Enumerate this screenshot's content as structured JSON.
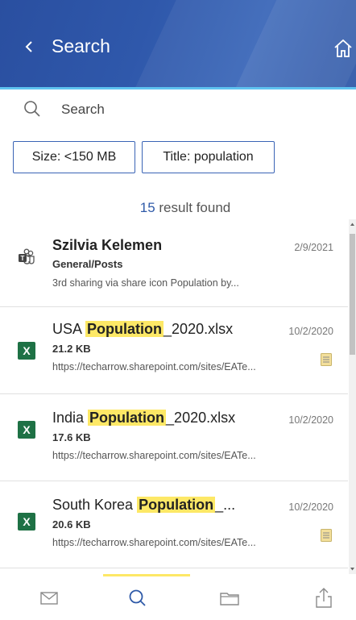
{
  "header": {
    "title": "Search"
  },
  "search": {
    "placeholder": "Search"
  },
  "filters": [
    {
      "label": "Size: <150 MB"
    },
    {
      "label": "Title: population"
    }
  ],
  "results": {
    "count": "15",
    "suffix": " result found"
  },
  "items": [
    {
      "name": "Szilvia Kelemen",
      "sub": "General/Posts",
      "url": "3rd sharing via share icon Population by...",
      "date": "2/9/2021",
      "icon": "teams-icon"
    },
    {
      "name_pre": "USA ",
      "name_hl": "Population",
      "name_post": "_2020.xlsx",
      "sub": "21.2 KB",
      "url": "https://techarrow.sharepoint.com/sites/EATe...",
      "date": "10/2/2020",
      "icon": "excel-icon"
    },
    {
      "name_pre": "India ",
      "name_hl": "Population",
      "name_post": "_2020.xlsx",
      "sub": "17.6 KB",
      "url": "https://techarrow.sharepoint.com/sites/EATe...",
      "date": "10/2/2020",
      "icon": "excel-icon"
    },
    {
      "name_pre": "South Korea ",
      "name_hl": "Population",
      "name_post": "_...",
      "sub": "20.6 KB",
      "url": "https://techarrow.sharepoint.com/sites/EATe...",
      "date": "10/2/2020",
      "icon": "excel-icon"
    }
  ],
  "colors": {
    "header": "#2f58ab",
    "accent": "#5fc3f0",
    "highlight": "#fde866",
    "excel": "#1e7145"
  }
}
